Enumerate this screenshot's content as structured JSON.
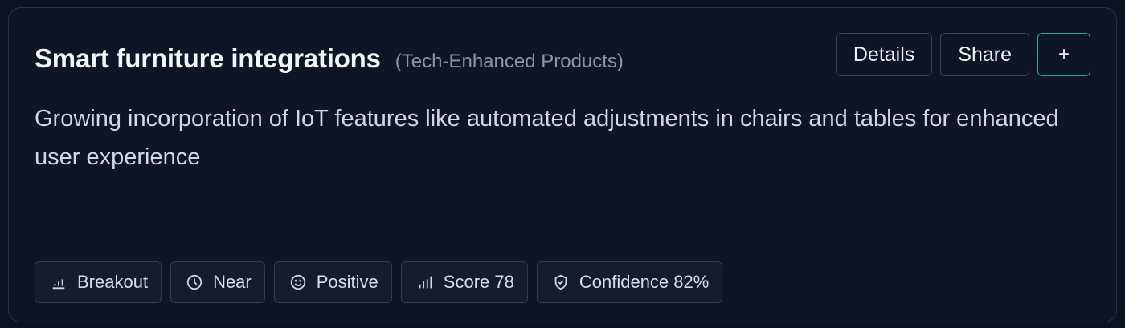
{
  "card": {
    "title": "Smart furniture integrations",
    "category": "(Tech-Enhanced Products)",
    "description": "Growing incorporation of IoT features like automated adjustments in chairs and tables for enhanced user experience",
    "actions": {
      "details_label": "Details",
      "share_label": "Share",
      "add_label": "+"
    },
    "tags": [
      {
        "label": "Breakout",
        "icon": "bar-chart-icon"
      },
      {
        "label": "Near",
        "icon": "clock-icon"
      },
      {
        "label": "Positive",
        "icon": "smile-icon"
      },
      {
        "label": "Score 78",
        "icon": "signal-bars-icon"
      },
      {
        "label": "Confidence 82%",
        "icon": "shield-check-icon"
      }
    ]
  },
  "colors": {
    "background": "#0b1220",
    "card": "#0d1526",
    "accent_border": "#2fa38c"
  }
}
